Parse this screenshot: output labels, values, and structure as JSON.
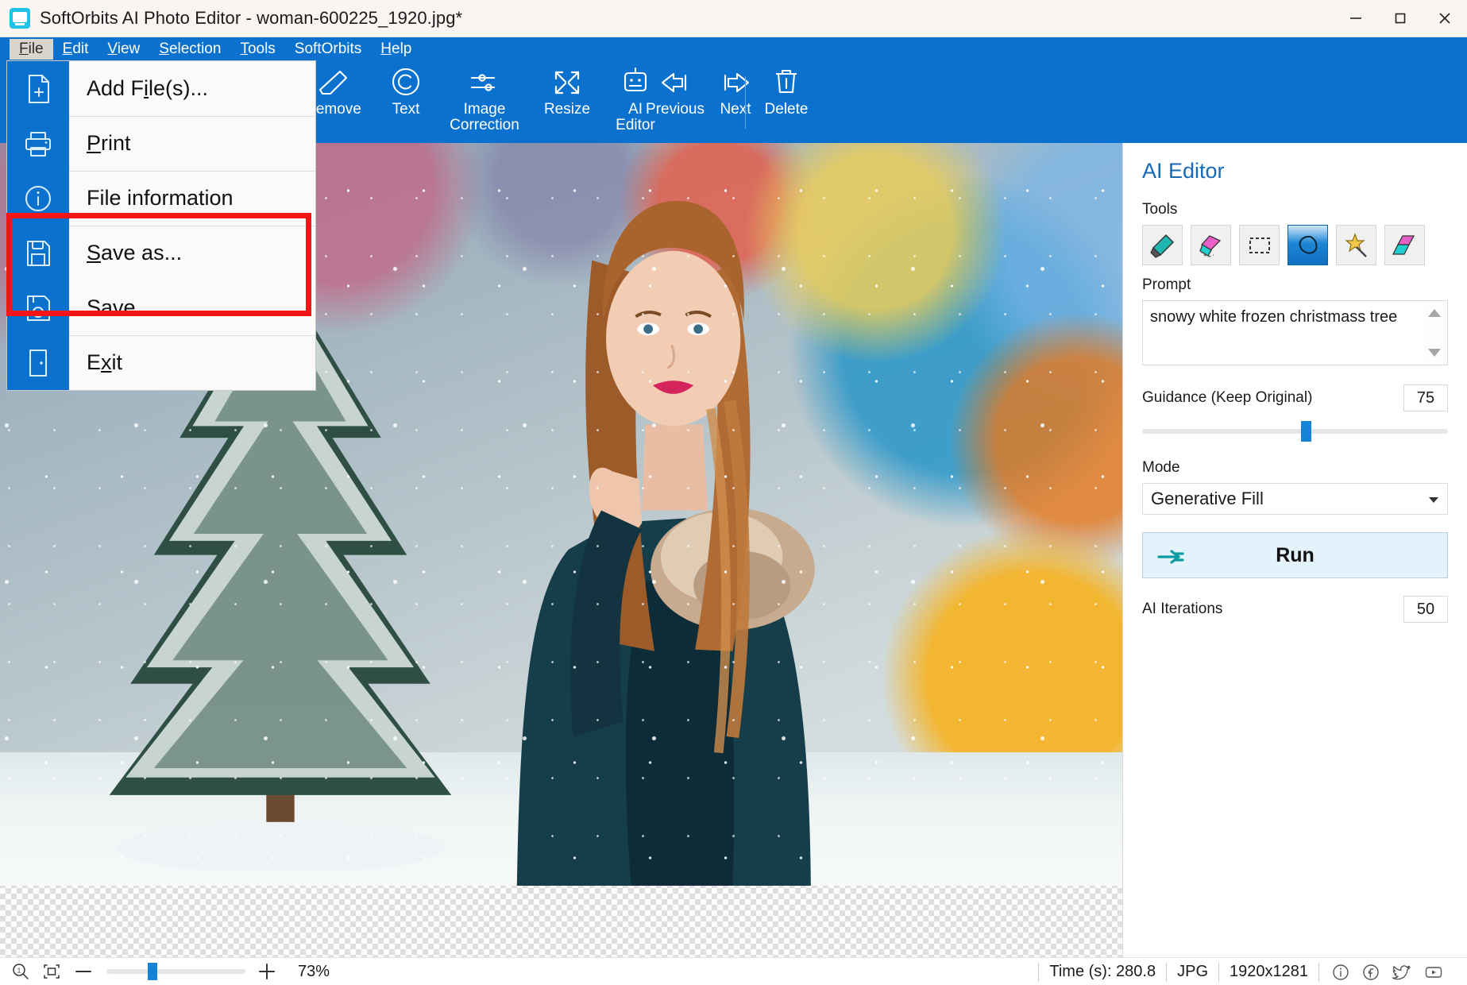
{
  "titlebar": {
    "app_icon": "softorbits-app-icon",
    "title": "SoftOrbits AI Photo Editor - woman-600225_1920.jpg*",
    "minimize": "minimize-icon",
    "maximize": "maximize-icon",
    "close": "close-icon"
  },
  "menubar": {
    "items": [
      {
        "label": "File",
        "active": true
      },
      {
        "label": "Edit",
        "active": false
      },
      {
        "label": "View",
        "active": false
      },
      {
        "label": "Selection",
        "active": false
      },
      {
        "label": "Tools",
        "active": false
      },
      {
        "label": "SoftOrbits",
        "active": false
      },
      {
        "label": "Help",
        "active": false
      }
    ]
  },
  "file_menu": {
    "items": [
      {
        "label": "Add File(s)...",
        "icon": "file-add-icon"
      },
      {
        "label": "Print",
        "icon": "printer-icon"
      },
      {
        "label": "File information",
        "icon": "info-circle-icon"
      },
      {
        "label": "Save as...",
        "icon": "floppy-disk-icon"
      },
      {
        "label": "Save",
        "icon": "save-disk-icon"
      },
      {
        "label": "Exit",
        "icon": "exit-door-icon"
      }
    ],
    "highlight_color": "#f41616"
  },
  "toolbar": {
    "items": [
      {
        "label": "e",
        "icon": "partial-label"
      },
      {
        "label": "Remove",
        "icon": "eraser-icon"
      },
      {
        "label": "Text",
        "icon": "copyright-icon"
      },
      {
        "label": "Image\nCorrection",
        "icon": "sliders-icon"
      },
      {
        "label": "Resize",
        "icon": "expand-arrows-icon"
      },
      {
        "label": "AI\nEditor",
        "icon": "robot-icon"
      },
      {
        "label": "Previous",
        "icon": "arrow-left-icon"
      },
      {
        "label": "Next",
        "icon": "arrow-right-icon"
      },
      {
        "label": "Delete",
        "icon": "trash-icon"
      }
    ],
    "background": "#0a72ce"
  },
  "panel": {
    "title": "AI Editor",
    "tools_label": "Tools",
    "tools": [
      {
        "name": "marker-tool",
        "selected": false
      },
      {
        "name": "eraser-tool",
        "selected": false
      },
      {
        "name": "rectangle-select-tool",
        "selected": false
      },
      {
        "name": "lasso-tool",
        "selected": true
      },
      {
        "name": "magic-wand-tool",
        "selected": false
      },
      {
        "name": "transform-tool",
        "selected": false
      }
    ],
    "prompt_label": "Prompt",
    "prompt_value": "snowy white frozen christmass tree",
    "guidance_label": "Guidance (Keep Original)",
    "guidance_value": "75",
    "mode_label": "Mode",
    "mode_value": "Generative Fill",
    "run_label": "Run",
    "iterations_label": "AI Iterations",
    "iterations_value": "50",
    "accent_color": "#1669b7"
  },
  "statusbar": {
    "zoom_reset_icon": "zoom-actual-size-icon",
    "fit_icon": "fit-to-window-icon",
    "zoom_out": "minus-icon",
    "zoom_in": "plus-icon",
    "zoom_percent": "73%",
    "time": "Time (s): 280.8",
    "format": "JPG",
    "dimensions": "1920x1281",
    "socials": [
      "info-icon",
      "facebook-icon",
      "twitter-icon",
      "youtube-icon"
    ]
  }
}
